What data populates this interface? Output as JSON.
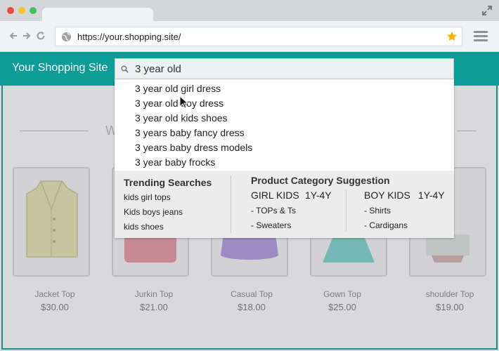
{
  "browser": {
    "url": "https://your.shopping.site/"
  },
  "site": {
    "title": "Your Shopping Site",
    "section_fragment": "W"
  },
  "search": {
    "value": "3 year old",
    "suggestions": [
      "3 year old girl dress",
      "3 year old boy dress",
      "3 year old kids shoes",
      "3 years baby fancy dress",
      "3 years baby dress models",
      "3 year baby frocks"
    ]
  },
  "trending": {
    "title": "Trending Searches",
    "items": [
      "kids girl tops",
      "Kids boys jeans",
      "kids shoes"
    ]
  },
  "categories": {
    "title": "Product Category Suggestion",
    "groups": [
      {
        "name": "GIRL KIDS",
        "age": "1Y-4Y",
        "items": [
          "- TOPs & Ts",
          "- Sweaters"
        ]
      },
      {
        "name": "BOY KIDS",
        "age": "1Y-4Y",
        "items": [
          "- Shirts",
          "- Cardigans"
        ]
      }
    ]
  },
  "products": [
    {
      "name": "Jacket Top",
      "price": "$30.00",
      "color": "#e6e6b4"
    },
    {
      "name": "Jurkin Top",
      "price": "$21.00",
      "color": "#e79aa6"
    },
    {
      "name": "Casual Top",
      "price": "$18.00",
      "color": "#b39ae0"
    },
    {
      "name": "Gown Top",
      "price": "$25.00",
      "color": "#7fd6d0"
    },
    {
      "name": "shoulder Top",
      "price": "$19.00",
      "color": "#dfe5df"
    }
  ],
  "colors": {
    "brand": "#0e9c97",
    "star": "#f4b400"
  }
}
